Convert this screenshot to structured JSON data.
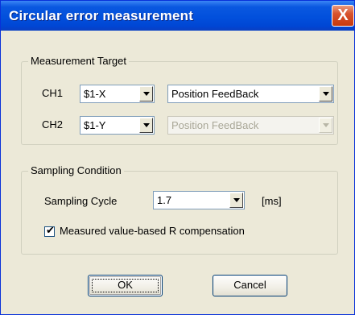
{
  "window": {
    "title": "Circular error measurement",
    "close_icon": "close-icon",
    "close_glyph": "X"
  },
  "measurement_target": {
    "legend": "Measurement Target",
    "ch1": {
      "label": "CH1",
      "axis": "$1-X",
      "signal": "Position FeedBack"
    },
    "ch2": {
      "label": "CH2",
      "axis": "$1-Y",
      "signal": "Position FeedBack",
      "signal_disabled": true
    }
  },
  "sampling_condition": {
    "legend": "Sampling Condition",
    "cycle_label": "Sampling Cycle",
    "cycle_value": "1.7",
    "cycle_unit": "[ms]",
    "r_comp_label": "Measured value-based R compensation",
    "r_comp_checked": true
  },
  "buttons": {
    "ok": "OK",
    "cancel": "Cancel"
  },
  "colors": {
    "title_bar": "#0250dc",
    "dialog_bg": "#ece9d8",
    "close_button": "#c7390d"
  }
}
